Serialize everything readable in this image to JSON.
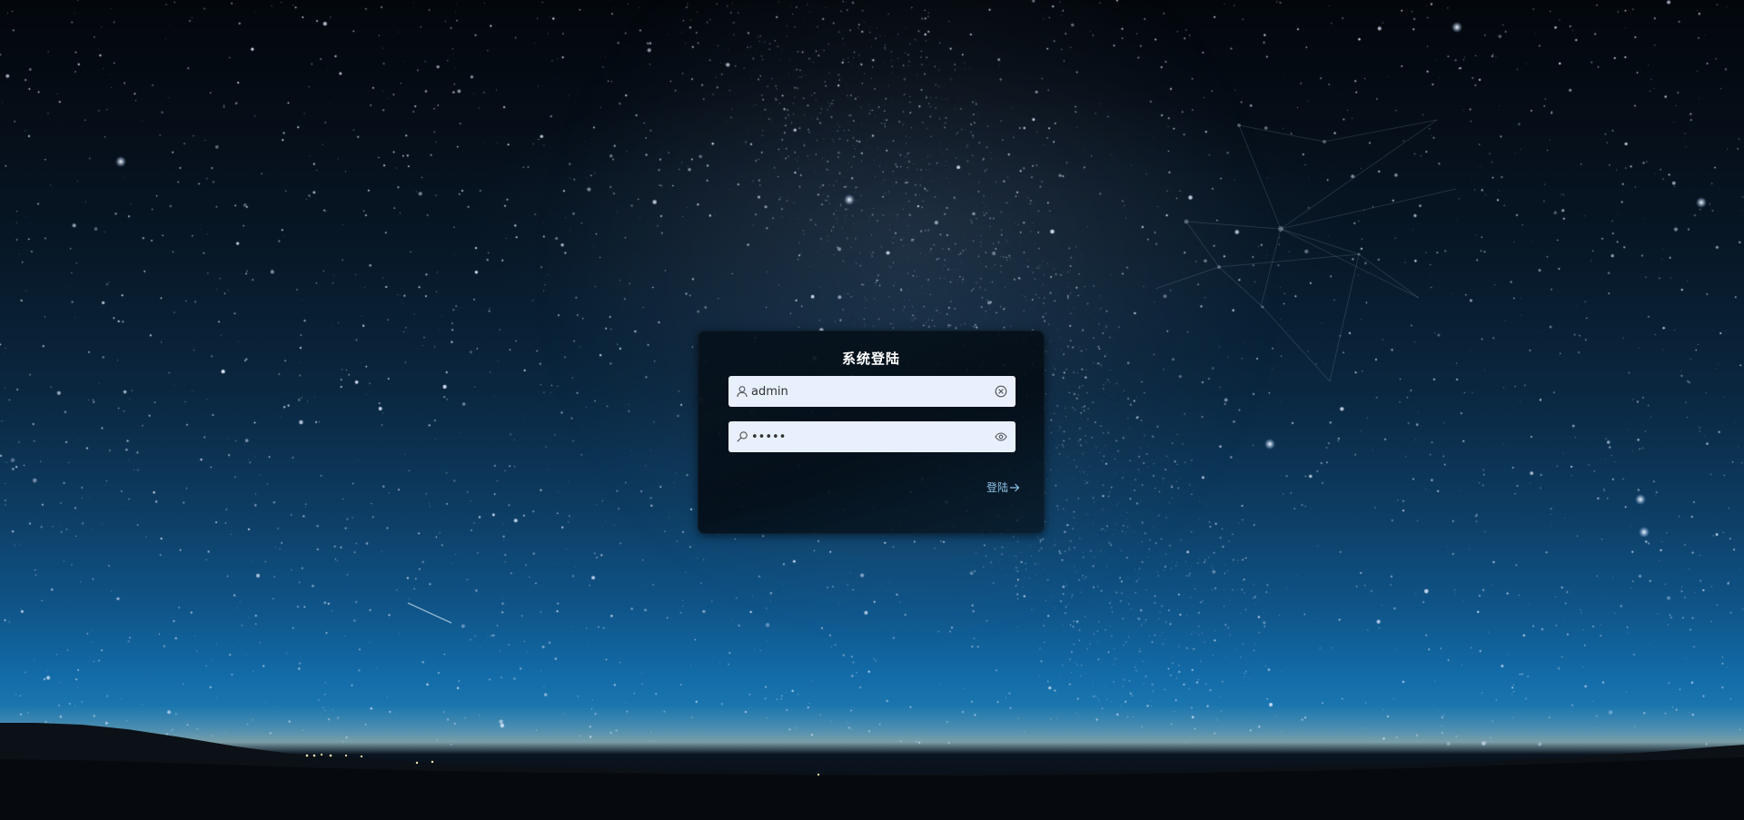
{
  "login": {
    "title": "系统登陆",
    "username": {
      "value": "admin",
      "prefix_icon": "user-icon",
      "suffix_icon": "circle-close-icon"
    },
    "password": {
      "value": "admin",
      "prefix_icon": "key-icon",
      "suffix_icon": "eye-icon"
    },
    "submit_label": "登陆",
    "submit_icon": "arrow-right-icon"
  },
  "colors": {
    "input_background": "#e8f0fe",
    "title_text": "#ffffff",
    "link_text": "#8fc3e6",
    "card_background": "#06121c"
  }
}
